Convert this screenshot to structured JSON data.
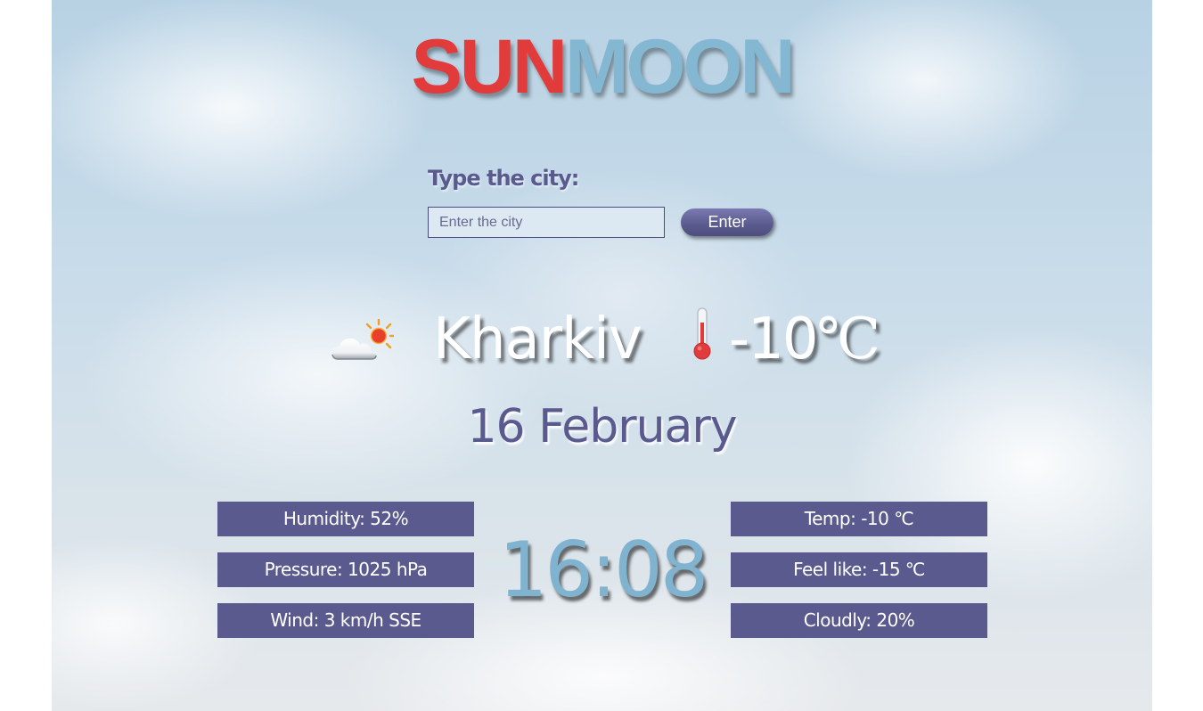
{
  "logo": {
    "part1": "SUN",
    "part2": "MOON",
    "color1": "#e23b3b",
    "color2": "#83b7d2"
  },
  "search": {
    "label": "Type the city:",
    "placeholder": "Enter the city",
    "value": "",
    "button_label": "Enter"
  },
  "current": {
    "weather_icon": "partly-cloudy-icon",
    "city": "Kharkiv",
    "thermometer_icon": "thermometer-icon",
    "temperature": "-10",
    "unit": "℃",
    "date": "16 February",
    "time": "16:08"
  },
  "stats_left": [
    {
      "text": "Humidity: 52%"
    },
    {
      "text": "Pressure: 1025 hPa"
    },
    {
      "text": "Wind: 3 km/h SSE"
    }
  ],
  "stats_right": [
    {
      "text": "Temp: -10 ℃"
    },
    {
      "text": "Feel like: -15 ℃"
    },
    {
      "text": "Cloudly: 20%"
    }
  ],
  "colors": {
    "accent": "#5a5a8e",
    "clock": "#7fb3cf"
  }
}
